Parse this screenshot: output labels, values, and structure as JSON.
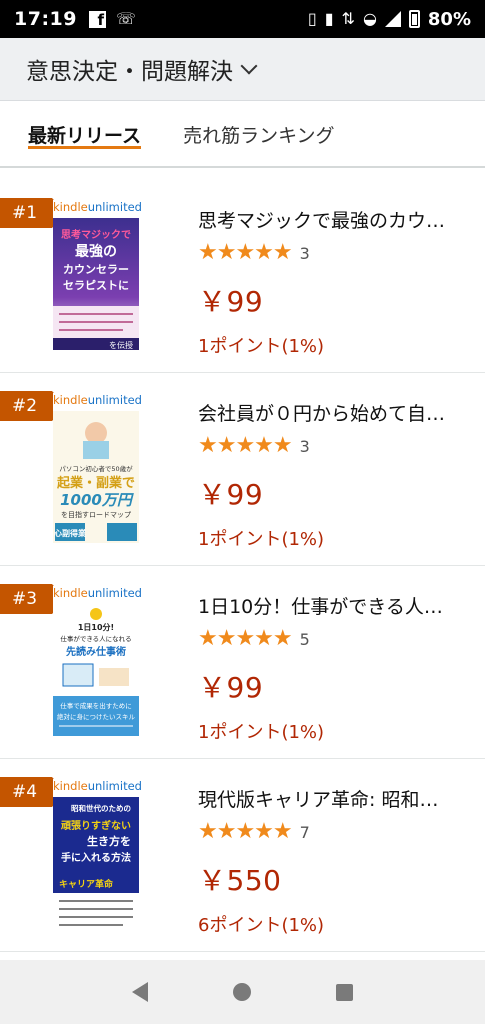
{
  "status_bar": {
    "time": "17:19",
    "battery_pct": "80%",
    "icons": [
      "facebook-icon",
      "wifi-call-icon",
      "nfc-icon",
      "vibrate-icon",
      "data-icon",
      "wifi-icon",
      "signal-icon",
      "battery-icon"
    ]
  },
  "header": {
    "category": "意思決定・問題解決"
  },
  "tabs": [
    {
      "label": "最新リリース",
      "active": true
    },
    {
      "label": "売れ筋ランキング",
      "active": false
    }
  ],
  "colors": {
    "accent": "#e47911",
    "rank_badge": "#c45500",
    "price": "#b12704",
    "stars": "#f08a1c"
  },
  "kindle_unlimited": {
    "part1": "kindle",
    "part2": "unlimited"
  },
  "items": [
    {
      "rank": "#1",
      "title": "思考マジックで最強のカウ…",
      "stars": "★★★★★",
      "rating_count": "3",
      "price": "￥99",
      "points": "1ポイント(1%)",
      "cover": {
        "line1": "思考マジックで",
        "line2": "最強の",
        "line3": "カウンセラー",
        "line4": "セラピストに",
        "footer": "を伝授"
      }
    },
    {
      "rank": "#2",
      "title": "会社員が０円から始めて自…",
      "stars": "★★★★★",
      "rating_count": "3",
      "price": "￥99",
      "points": "1ポイント(1%)",
      "cover": {
        "line1": "パソコン初心者で50歳が",
        "line2": "起業・副業で",
        "line3": "1000万円",
        "line4": "を目指すロードマップ",
        "footer": "心副得業"
      }
    },
    {
      "rank": "#3",
      "title": "1日10分！仕事ができる人…",
      "stars": "★★★★★",
      "rating_count": "5",
      "price": "￥99",
      "points": "1ポイント(1%)",
      "cover": {
        "line1": "1日10分!",
        "line2": "仕事ができる人になれる",
        "line3": "先読み仕事術",
        "line4": "仕事で成果を出すために",
        "footer": "絶対に身につけたいスキル"
      }
    },
    {
      "rank": "#4",
      "title": "現代版キャリア革命: 昭和…",
      "stars": "★★★★★",
      "rating_count": "7",
      "price": "￥550",
      "points": "6ポイント(1%)",
      "cover": {
        "line1": "昭和世代のための",
        "line2": "頑張りすぎない",
        "line3": "生き方を",
        "line4": "手に入れる方法",
        "footer": "キャリア革命"
      }
    }
  ]
}
